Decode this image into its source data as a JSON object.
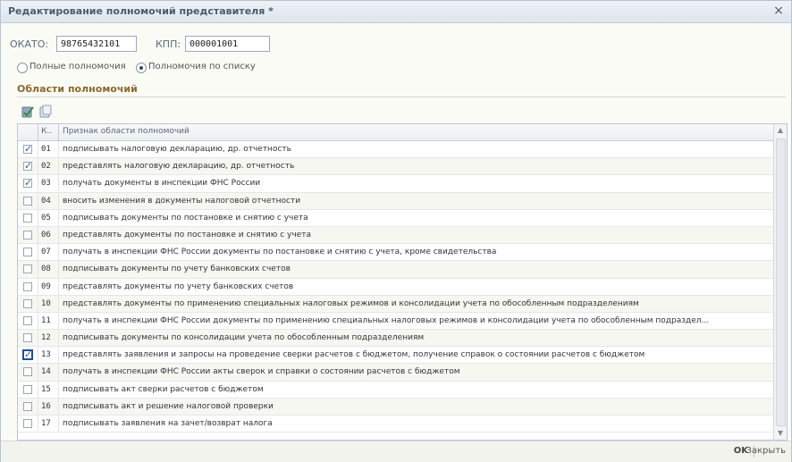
{
  "window": {
    "title": "Редактирование полномочий представителя *",
    "close_glyph": "×"
  },
  "fields": {
    "okato_label": "ОКАТО:",
    "okato_value": "98765432101",
    "kpp_label": "КПП:",
    "kpp_value": "000001001"
  },
  "radios": {
    "full": {
      "label": "Полные полномочия",
      "selected": false
    },
    "list": {
      "label": "Полномочия по списку",
      "selected": true
    }
  },
  "section": {
    "title": "Области полномочий"
  },
  "toolbar": {
    "icons": [
      "check-all-icon",
      "uncheck-all-icon"
    ]
  },
  "table": {
    "columns": [
      "К..",
      "Признак области полномочий"
    ],
    "rows": [
      {
        "checked": true,
        "code": "01",
        "text": "подписывать налоговую декларацию, др. отчетность"
      },
      {
        "checked": true,
        "code": "02",
        "text": "представлять налоговую декларацию, др. отчетность"
      },
      {
        "checked": true,
        "code": "03",
        "text": "получать документы в инспекции ФНС России"
      },
      {
        "checked": false,
        "code": "04",
        "text": "вносить изменения в документы налоговой отчетности"
      },
      {
        "checked": false,
        "code": "05",
        "text": "подписывать документы по постановке и снятию с учета"
      },
      {
        "checked": false,
        "code": "06",
        "text": "представлять документы по постановке и снятию с учета"
      },
      {
        "checked": false,
        "code": "07",
        "text": "получать в инспекции ФНС России документы по постановке и снятию с учета, кроме свидетельства"
      },
      {
        "checked": false,
        "code": "08",
        "text": "подписывать документы по учету банковских счетов"
      },
      {
        "checked": false,
        "code": "09",
        "text": "представлять документы по учету банковских счетов"
      },
      {
        "checked": false,
        "code": "10",
        "text": "представлять документы по применению специальных налоговых режимов и консолидации учета по обособленным подразделениям"
      },
      {
        "checked": false,
        "code": "11",
        "text": "получать в инспекции ФНС России документы по применению специальных налоговых режимов и консолидации учета по обособленным подраздел..."
      },
      {
        "checked": false,
        "code": "12",
        "text": "подписывать документы по консолидации учета по обособленным подразделениям"
      },
      {
        "checked": true,
        "code": "13",
        "text": "представлять заявления и запросы на проведение сверки расчетов с бюджетом, получение справок о состоянии расчетов с бюджетом",
        "focused": true
      },
      {
        "checked": false,
        "code": "14",
        "text": "получать в инспекции ФНС России акты сверок и справки о состоянии расчетов с бюджетом"
      },
      {
        "checked": false,
        "code": "15",
        "text": "подписывать акт сверки расчетов с бюджетом"
      },
      {
        "checked": false,
        "code": "16",
        "text": "подписывать акт и решение налоговой проверки"
      },
      {
        "checked": false,
        "code": "17",
        "text": "подписывать заявления на зачет/возврат налога"
      }
    ]
  },
  "footer": {
    "ok_label": "OK",
    "close_label": "Закрыть"
  }
}
